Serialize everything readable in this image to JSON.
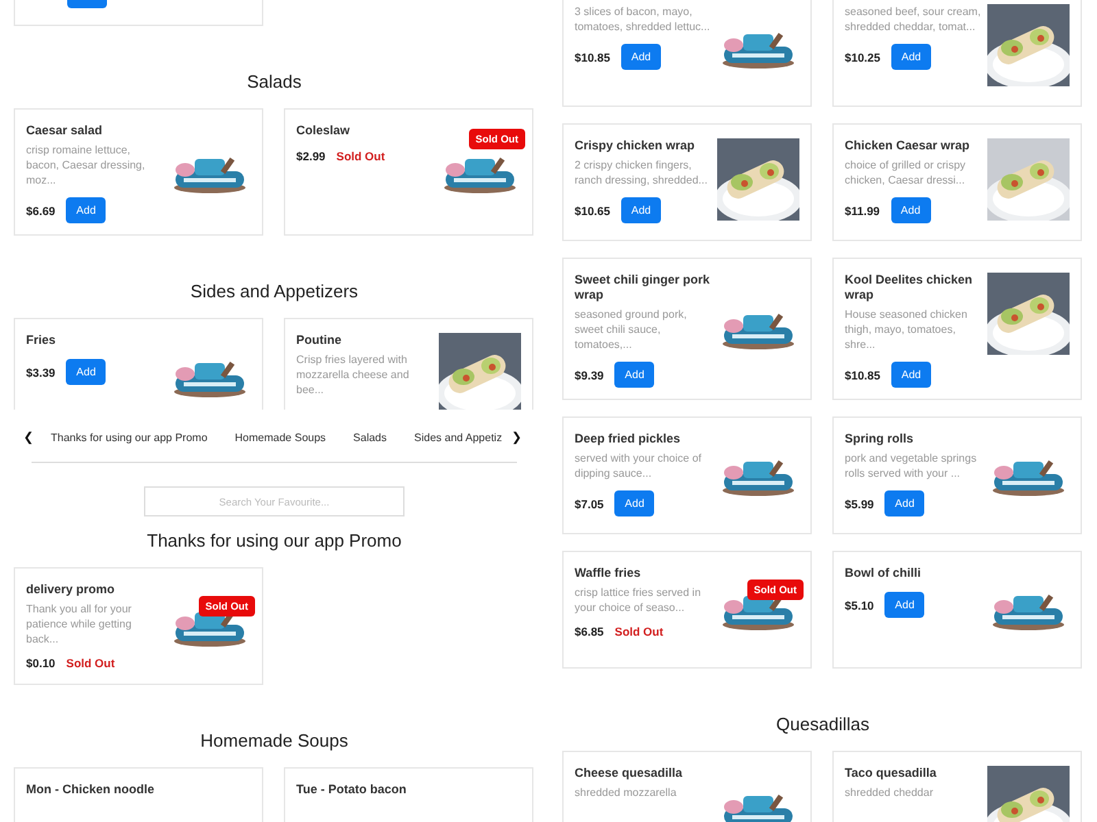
{
  "left_column": [
    {
      "kind": "cards_top_cut",
      "items": [
        {
          "kind": "stub"
        }
      ]
    },
    {
      "kind": "heading",
      "text": "Salads"
    },
    {
      "kind": "cards",
      "items": [
        {
          "kind": "item_with_logo",
          "name": "Caesar salad",
          "description": "crisp romaine lettuce, bacon, Caesar dressing, moz...",
          "price": "$6.69",
          "button": "Add"
        },
        {
          "kind": "item_with_logo",
          "name": "Coleslaw",
          "price": "$2.99",
          "status": "Sold Out",
          "badge": "Sold Out"
        }
      ]
    },
    {
      "kind": "heading",
      "text": "Sides and Appetizers"
    },
    {
      "kind": "cards_bottom_cut",
      "items": [
        {
          "kind": "item_with_logo",
          "name": "Fries",
          "price": "$3.39",
          "button": "Add"
        },
        {
          "kind": "item_with_photo",
          "name": "Poutine",
          "description": "Crisp fries layered with mozzarella cheese and bee..."
        }
      ]
    },
    {
      "kind": "nav",
      "prev": "❮",
      "next": "❯",
      "tabs": [
        "Thanks for using our app Promo",
        "Homemade Soups",
        "Salads",
        "Sides and Appetiz"
      ]
    },
    {
      "kind": "search",
      "placeholder": "Search Your Favourite..."
    },
    {
      "kind": "heading",
      "text": "Thanks for using our app Promo"
    },
    {
      "kind": "cards",
      "items": [
        {
          "kind": "item_with_logo",
          "name": "delivery promo",
          "description": "Thank you all for your patience while getting back...",
          "price": "$0.10",
          "status": "Sold Out",
          "badge": "Sold Out"
        }
      ]
    },
    {
      "kind": "heading",
      "text": "Homemade Soups"
    },
    {
      "kind": "cards",
      "items": [
        {
          "kind": "item_plain",
          "name": "Mon - Chicken noodle"
        },
        {
          "kind": "item_plain",
          "name": "Tue - Potato bacon"
        }
      ]
    }
  ],
  "right_column": [
    {
      "kind": "cards_top_cut",
      "items": [
        {
          "kind": "item_with_logo",
          "description": "3 slices of bacon, mayo, tomatoes, shredded lettuc...",
          "price": "$10.85",
          "button": "Add"
        },
        {
          "kind": "item_with_photo",
          "description": "seasoned beef, sour cream, shredded cheddar, tomat...",
          "price": "$10.25",
          "button": "Add"
        }
      ]
    },
    {
      "kind": "cards",
      "items": [
        {
          "kind": "item_with_photo",
          "name": "Crispy chicken wrap",
          "description": "2 crispy chicken fingers, ranch dressing, shredded...",
          "price": "$10.65",
          "button": "Add"
        },
        {
          "kind": "item_with_photo",
          "name": "Chicken Caesar wrap",
          "description": "choice of grilled or crispy chicken, Caesar dressi...",
          "price": "$11.99",
          "button": "Add"
        }
      ]
    },
    {
      "kind": "cards",
      "items": [
        {
          "kind": "item_with_logo",
          "name": "Sweet chili ginger pork wrap",
          "description": "seasoned ground pork, sweet chili sauce, tomatoes,...",
          "price": "$9.39",
          "button": "Add"
        },
        {
          "kind": "item_with_photo",
          "name": "Kool Deelites chicken wrap",
          "description": "House seasoned chicken thigh, mayo, tomatoes, shre...",
          "price": "$10.85",
          "button": "Add"
        }
      ]
    },
    {
      "kind": "cards",
      "items": [
        {
          "kind": "item_with_logo",
          "name": "Deep fried pickles",
          "description": "served with your choice of dipping sauce...",
          "price": "$7.05",
          "button": "Add"
        },
        {
          "kind": "item_with_logo",
          "name": "Spring rolls",
          "description": "pork and vegetable springs rolls served with your ...",
          "price": "$5.99",
          "button": "Add"
        }
      ]
    },
    {
      "kind": "cards",
      "items": [
        {
          "kind": "item_with_logo",
          "name": "Waffle fries",
          "description": "crisp lattice fries served in your choice of seaso...",
          "price": "$6.85",
          "status": "Sold Out",
          "badge": "Sold Out"
        },
        {
          "kind": "item_with_logo",
          "name": "Bowl of chilli",
          "price": "$5.10",
          "button": "Add"
        }
      ]
    },
    {
      "kind": "heading",
      "text": "Quesadillas"
    },
    {
      "kind": "cards",
      "items": [
        {
          "kind": "item_with_logo",
          "name": "Cheese quesadilla",
          "description": "shredded mozzarella"
        },
        {
          "kind": "item_with_photo",
          "name": "Taco quesadilla",
          "description": "shredded cheddar"
        }
      ]
    }
  ]
}
